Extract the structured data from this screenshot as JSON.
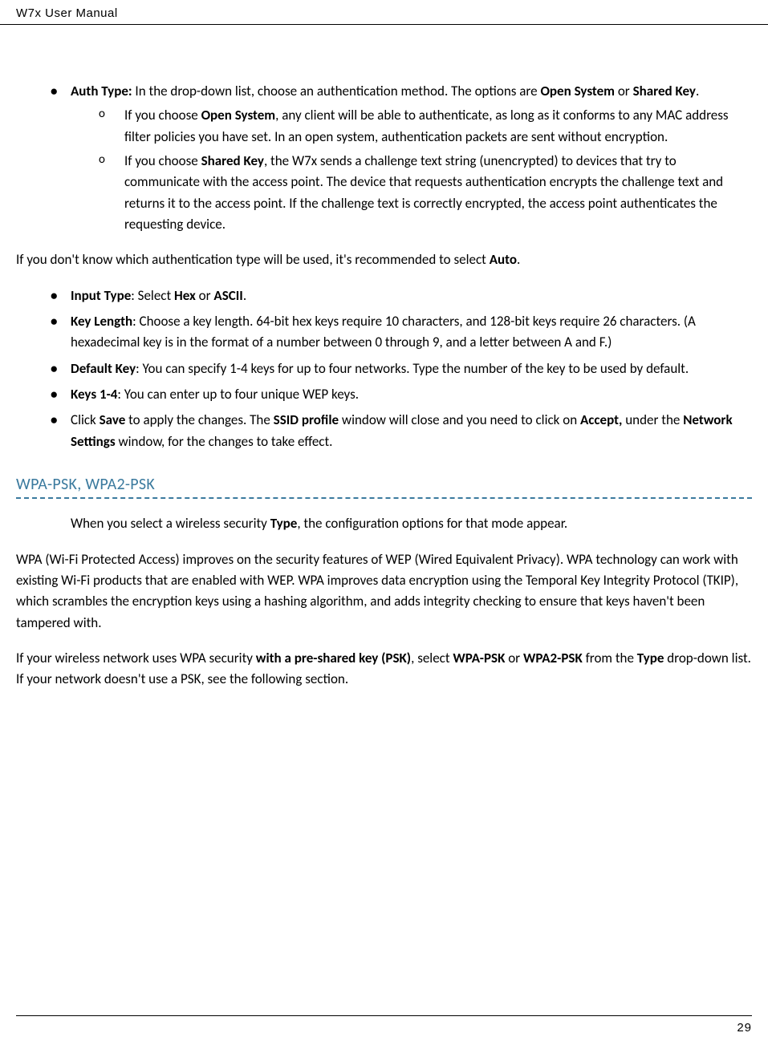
{
  "header": {
    "title": "W7x User Manual"
  },
  "footer": {
    "page_number": "29"
  },
  "section1": {
    "auth_type_label": "Auth Type:",
    "auth_type_text": " In the drop-down list, choose an authentication method. The options are ",
    "auth_type_opt1": "Open System",
    "auth_type_or": " or ",
    "auth_type_opt2": "Shared Key",
    "auth_type_period": ".",
    "open_system_prefix": "If you choose ",
    "open_system_bold": "Open System",
    "open_system_text": ", any client will be able to authenticate, as long as it conforms to any MAC address filter policies you have set. In an open system, authentication packets are sent without encryption.",
    "shared_key_prefix": "If you choose ",
    "shared_key_bold": "Shared Key",
    "shared_key_text": ", the W7x sends a challenge text string (unencrypted) to devices that try to communicate with the access point. The device that requests authentication encrypts the challenge text and returns it to the access point. If the challenge text is correctly encrypted, the access point authenticates the requesting device."
  },
  "para_auto": {
    "prefix": "If you don't know which authentication type will be used, it's recommended to select ",
    "bold": "Auto",
    "suffix": "."
  },
  "section2": {
    "input_type_label": "Input Type",
    "input_type_text": ": Select ",
    "input_type_hex": "Hex",
    "input_type_or": " or ",
    "input_type_ascii": "ASCII",
    "input_type_period": ".",
    "key_length_label": "Key Length",
    "key_length_text": ": Choose a key length. 64-bit hex keys require 10 characters, and 128-bit keys require 26 characters. (A hexadecimal key is in the format of a number between 0 through 9, and a letter between A and F.)",
    "default_key_label": "Default Key",
    "default_key_text": ": You can specify 1-4 keys for up to four networks. Type the number of the key to be used by default.",
    "keys14_label": "Keys 1-4",
    "keys14_text": ": You can enter up to four unique WEP keys.",
    "save_prefix": "Click ",
    "save_bold": "Save",
    "save_mid1": " to apply the changes. The ",
    "ssid_profile": "SSID profile",
    "save_mid2": " window will close and you need to click on ",
    "accept_bold": "Accept,",
    "save_mid3": " under the ",
    "network_settings": "Network Settings",
    "save_end": " window, for the changes to take effect."
  },
  "heading": {
    "wpa_psk": "WPA-PSK, WPA2-PSK"
  },
  "section3": {
    "p1_prefix": "When you select a wireless security ",
    "p1_type": "Type",
    "p1_suffix": ", the configuration options for that mode appear.",
    "p2": "WPA (Wi-Fi Protected Access) improves on the security features of WEP (Wired Equivalent Privacy). WPA technology can work with existing Wi-Fi products that are enabled with WEP. WPA improves data encryption using the Temporal Key Integrity Protocol (TKIP), which scrambles the encryption keys using a hashing algorithm, and adds integrity checking to ensure that keys haven't been tampered with.",
    "p3_prefix": "If your wireless network uses WPA security ",
    "p3_psk": "with a pre-shared key (PSK)",
    "p3_mid1": ", select ",
    "p3_wpa": "WPA-PSK",
    "p3_or": " or ",
    "p3_wpa2": "WPA2-PSK",
    "p3_mid2": " from the ",
    "p3_type": "Type",
    "p3_suffix": " drop-down list. If your network doesn't use a PSK, see the following section."
  }
}
